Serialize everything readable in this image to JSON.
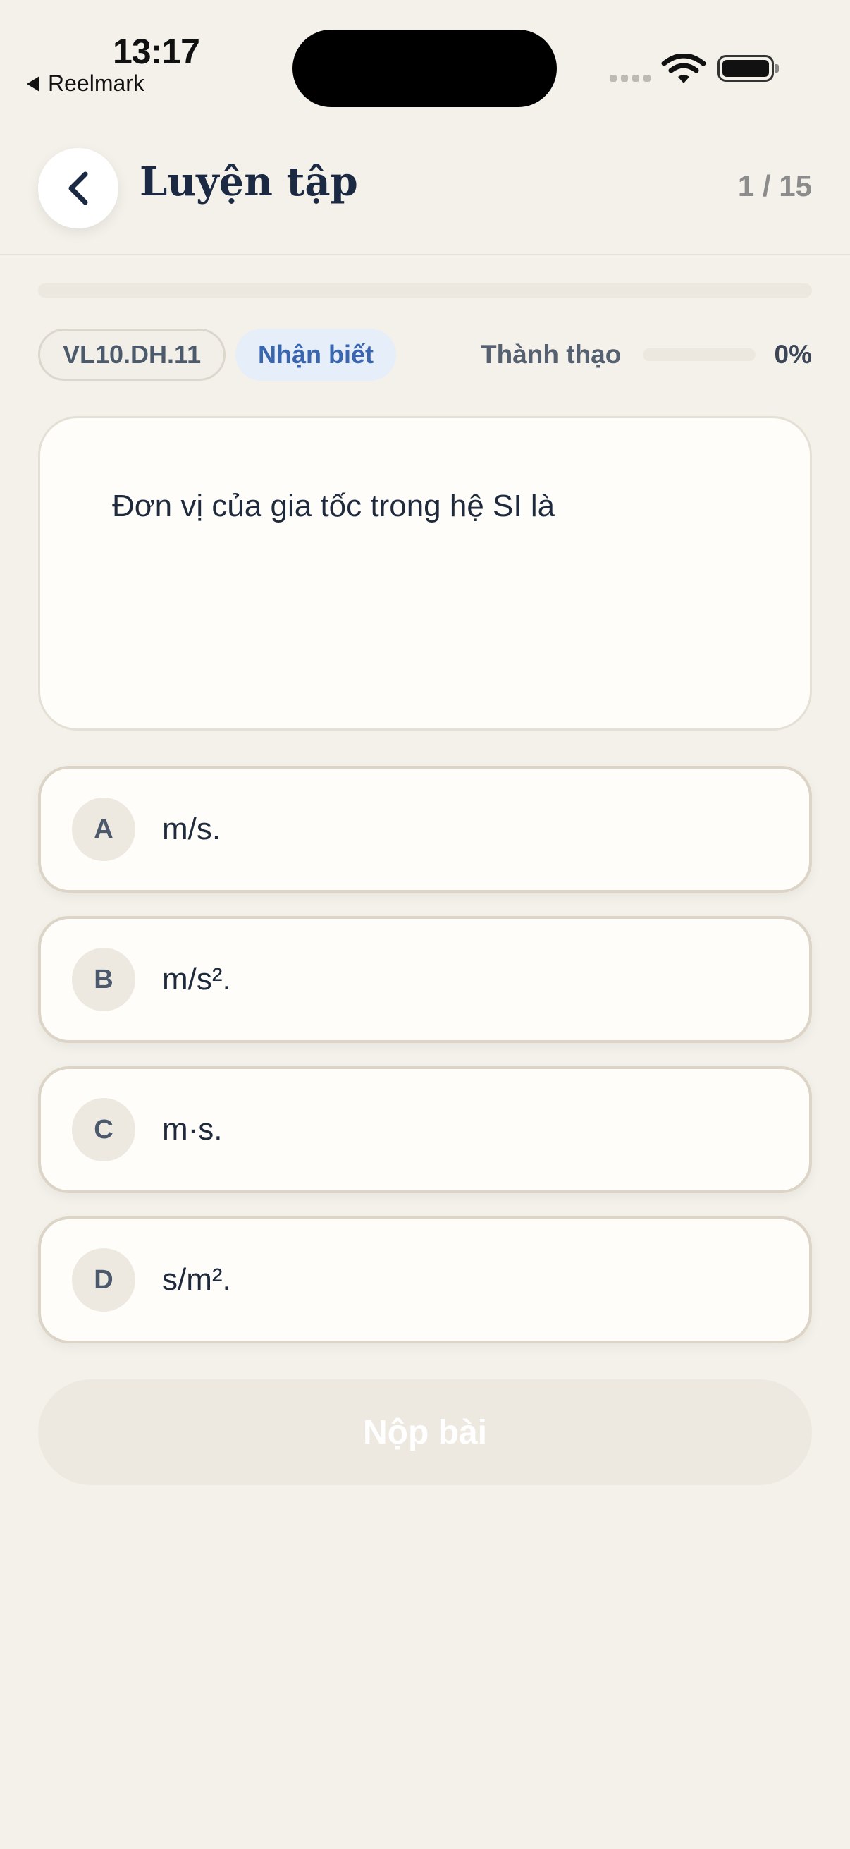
{
  "status_bar": {
    "time": "13:17",
    "back_app": "Reelmark",
    "icons": [
      "signal-icon",
      "wifi-icon",
      "battery-icon"
    ]
  },
  "header": {
    "back_icon": "chevron-left-icon",
    "title": "Luyện tập",
    "counter": "1 / 15",
    "progress": 0
  },
  "tags": {
    "code": "VL10.DH.11",
    "level": "Nhận biết"
  },
  "mastery": {
    "label": "Thành thạo",
    "value": "0%",
    "percent": 0
  },
  "question": {
    "text": "Đơn vị của gia tốc trong hệ SI là"
  },
  "options": [
    {
      "letter": "A",
      "text": "m/s."
    },
    {
      "letter": "B",
      "text": "m/s²."
    },
    {
      "letter": "C",
      "text": "m·s."
    },
    {
      "letter": "D",
      "text": "s/m²."
    }
  ],
  "submit": {
    "label": "Nộp bài",
    "enabled": false
  },
  "colors": {
    "background": "#f4f1eb",
    "card": "#fefdf9",
    "title": "#1c2942",
    "level_tag_bg": "#e6eef9",
    "level_tag_text": "#3a66b0",
    "option_border": "#dcd4c6"
  }
}
